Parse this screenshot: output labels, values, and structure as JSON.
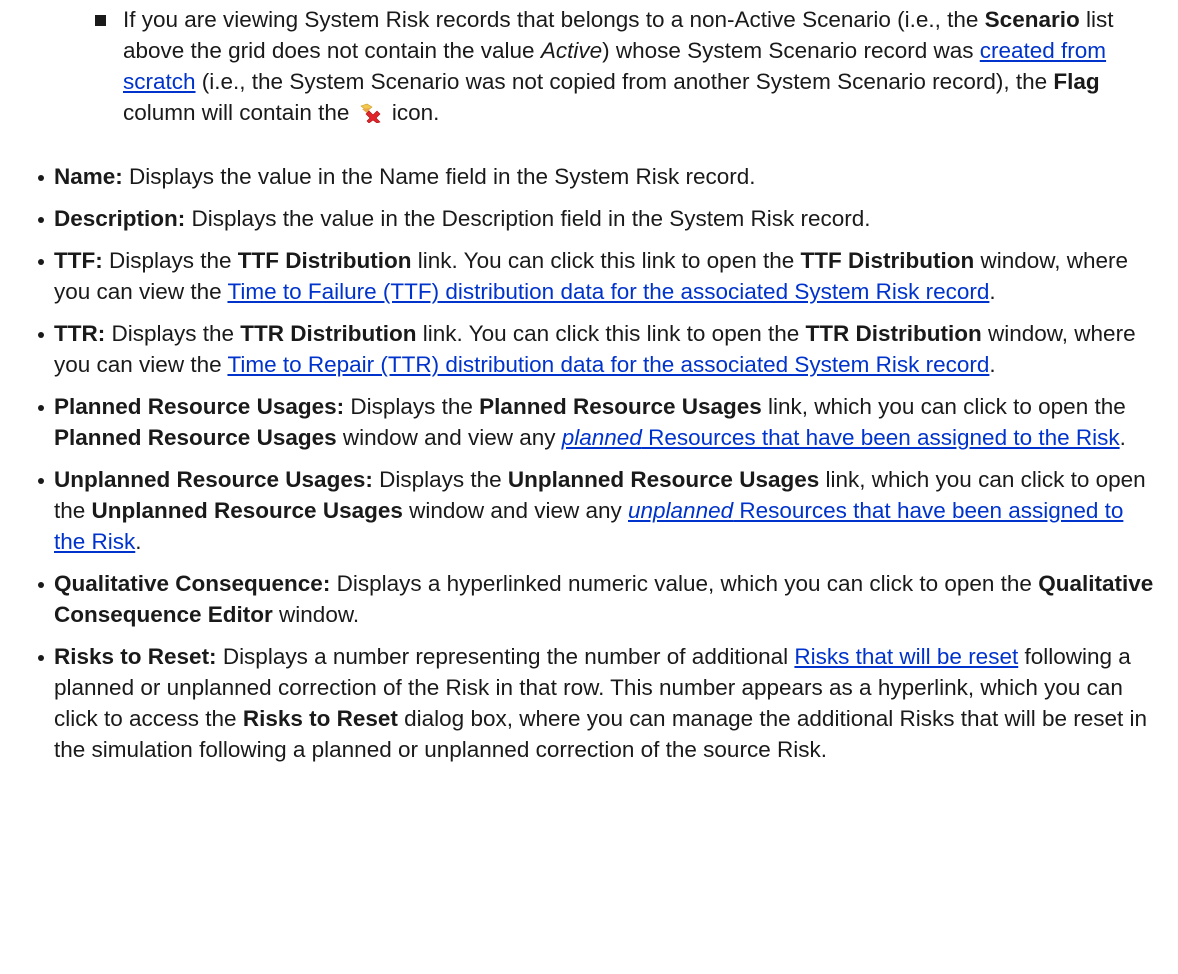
{
  "sub_bullet": {
    "p1": "If you are viewing System Risk records that belongs to a non-Active Scenario (i.e., the ",
    "scenario": "Scenario",
    "p2": " list above the grid does not contain the value ",
    "active": "Active",
    "p3": ") whose System Scenario record was ",
    "link_scratch": "created from scratch",
    "p4": " (i.e., the System Scenario was not copied from another System Scenario record), the ",
    "flag": "Flag",
    "p5": " column will contain the ",
    "p6": " icon.",
    "icon": "flag-delete-icon"
  },
  "items": [
    {
      "term": "Name:",
      "t1": " Displays the value in the Name field in the System Risk record."
    },
    {
      "term": "Description:",
      "t1": " Displays the value in the Description field in the System Risk record."
    },
    {
      "term": "TTF:",
      "t1": " Displays the ",
      "b1": "TTF Distribution",
      "t2": " link. You can click this link to open the ",
      "b2": "TTF Dis­tribution",
      "t3": " window, where you can view the ",
      "link": "Time to Failure (TTF) distribution data for the associated System Risk record",
      "t4": "."
    },
    {
      "term": "TTR:",
      "t1": " Displays the ",
      "b1": "TTR Distribution",
      "t2": " link. You can click this link to open the ",
      "b2": "TTR Dis­tribution",
      "t3": " window, where you can view the ",
      "link": "Time to Repair (TTR) distribution data for the associated System Risk record",
      "t4": "."
    },
    {
      "term": "Planned Resource Usages:",
      "t1": " Displays the ",
      "b1": "Planned Resource Usages",
      "t2": " link, which you can click to open the ",
      "b2": "Planned Resource Usages",
      "t3": " window and view any ",
      "link_em": "planned",
      "link": " Resources that have been assigned to the Risk",
      "t4": "."
    },
    {
      "term": "Unplanned Resource Usages:",
      "t1": " Displays the ",
      "b1": "Unplanned Resource Usages",
      "t2": " link, which you can click to open the ",
      "b2": "Unplanned Resource Usages",
      "t3": " window and view any ",
      "link_em": "unplanned",
      "link": " Resources that have been assigned to the Risk",
      "t4": "."
    },
    {
      "term": "Qualitative Consequence:",
      "t1": " Displays a hyperlinked numeric value, which you can click to open the ",
      "b1": "Qualitative Consequence Editor",
      "t2": " window."
    },
    {
      "term": "Risks to Reset:",
      "t1": " Displays a number representing the number of additional ",
      "link": "Risks that will be reset",
      "t2": " following a planned or unplanned correction of the Risk in that row. This number appears as a hyperlink, which you can click to access the ",
      "b1": "Risks to Reset",
      "t3": " dialog box, where you can manage the additional Risks that will be reset in the simulation following a planned or unplanned correction of the source Risk."
    }
  ]
}
